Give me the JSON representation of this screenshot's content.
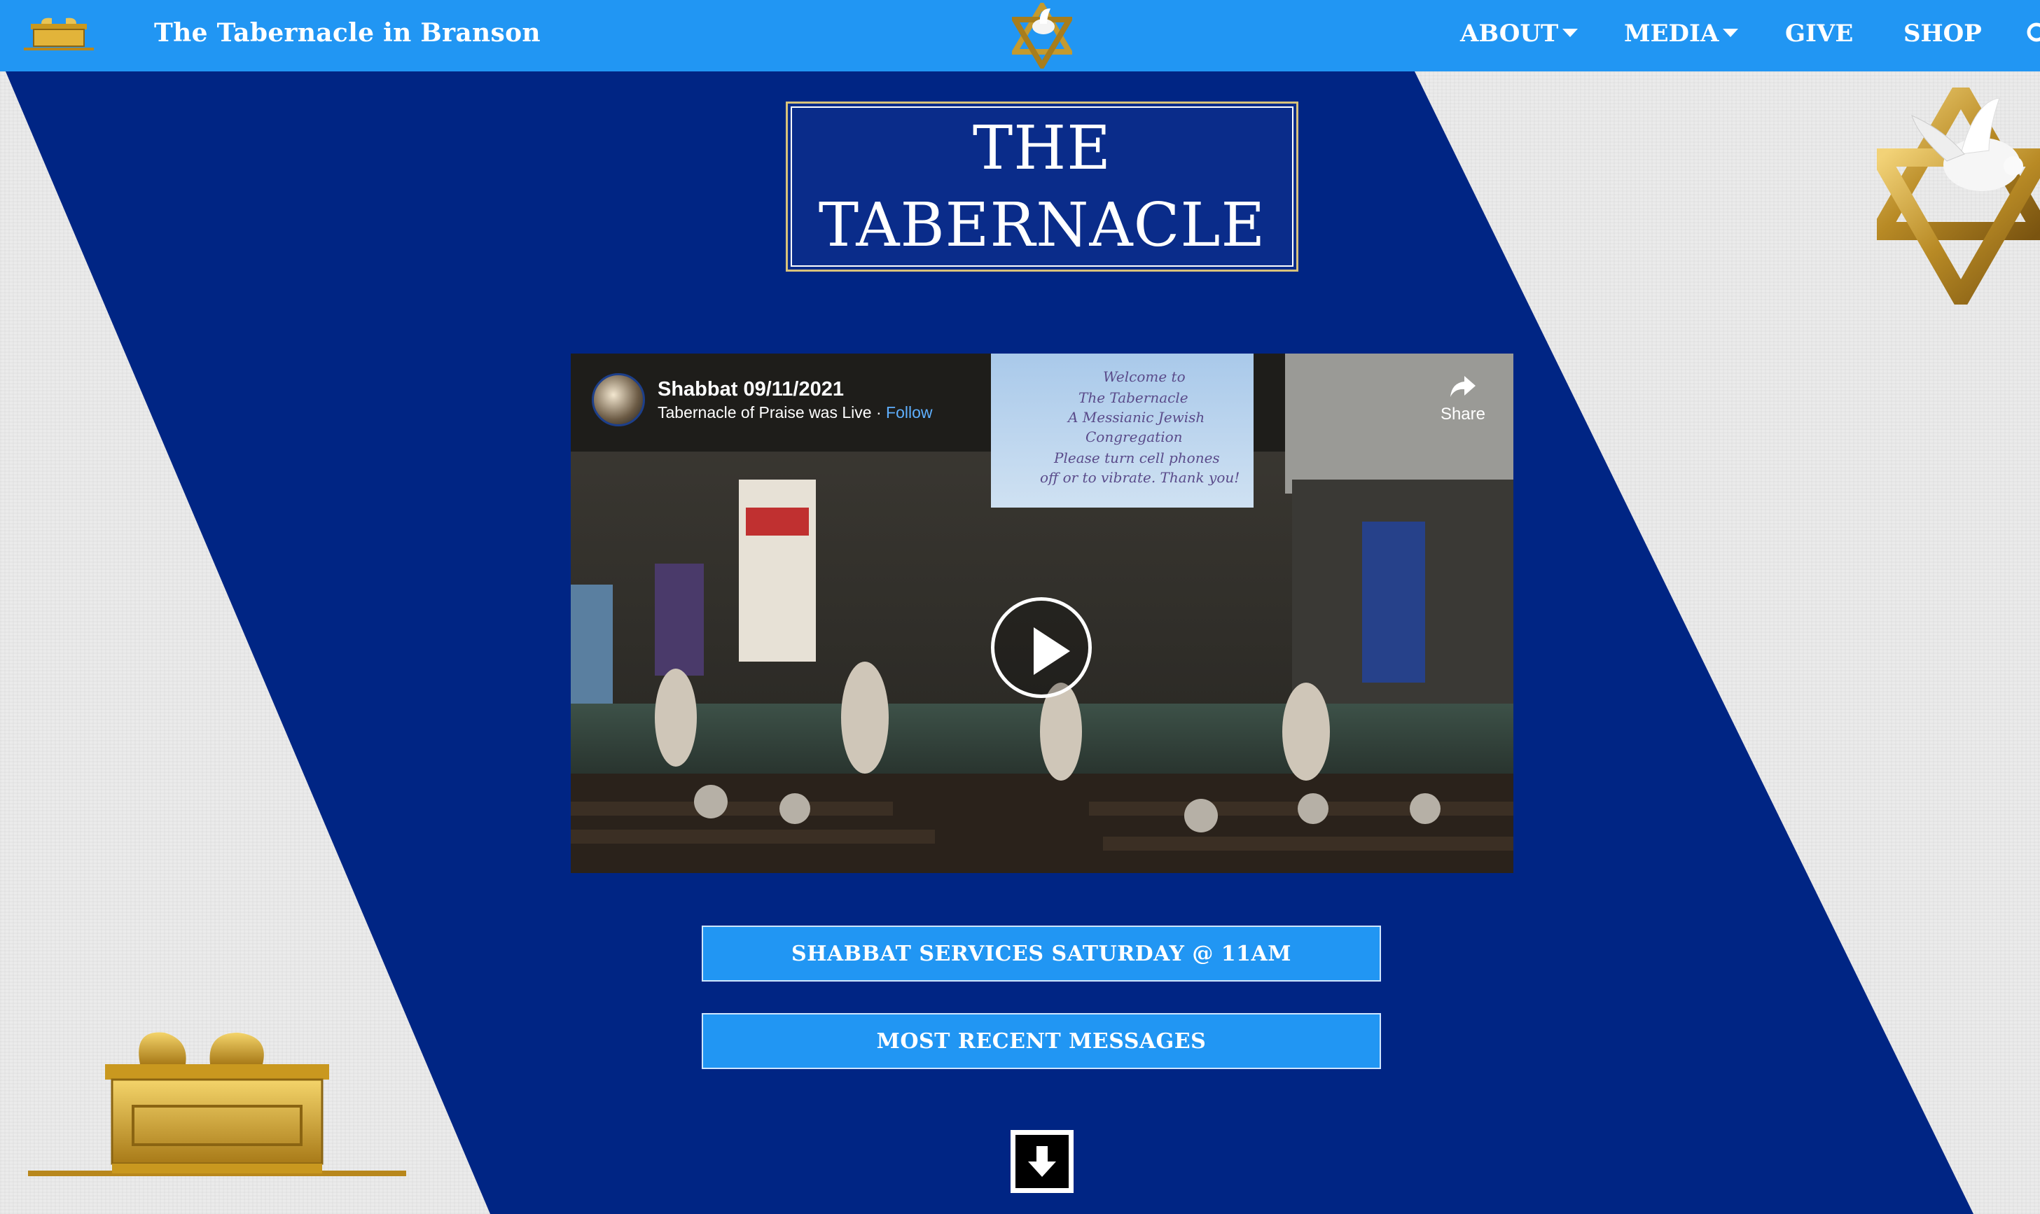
{
  "navbar": {
    "brand": "The Tabernacle in Branson",
    "items": [
      {
        "label": "ABOUT",
        "has_dropdown": true
      },
      {
        "label": "MEDIA",
        "has_dropdown": true
      },
      {
        "label": "GIVE",
        "has_dropdown": false
      },
      {
        "label": "SHOP",
        "has_dropdown": false
      }
    ],
    "icons": [
      "ark-logo-icon",
      "star-dove-logo-icon",
      "search-icon"
    ]
  },
  "hero": {
    "title_line1": "THE",
    "title_line2": "TABERNACLE"
  },
  "video": {
    "title": "Shabbat 09/11/2021",
    "subtitle": "Tabernacle of Praise was Live",
    "separator": "·",
    "follow_label": "Follow",
    "share_label": "Share"
  },
  "buttons": {
    "shabbat": "SHABBAT SERVICES SATURDAY @ 11AM",
    "messages": "MOST RECENT MESSAGES"
  },
  "colors": {
    "nav_blue": "#2196f3",
    "royal_blue": "#002584",
    "gold": "#d4a833"
  }
}
